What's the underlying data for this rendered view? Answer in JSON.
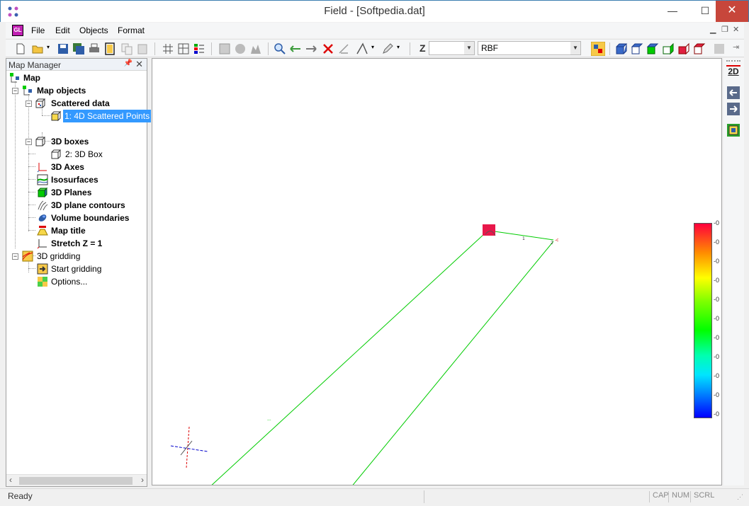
{
  "window": {
    "title": "Field - [Softpedia.dat]"
  },
  "menu": {
    "items": [
      "File",
      "Edit",
      "Objects",
      "Format"
    ],
    "doc_icon_text": "GL"
  },
  "toolbar": {
    "z_label": "Z",
    "z_combo_value": "",
    "method_combo_value": "RBF"
  },
  "panel": {
    "title": "Map Manager",
    "tree": {
      "map": "Map",
      "map_objects": "Map objects",
      "scattered_data": "Scattered data",
      "scattered_points": "1: 4D Scattered Points",
      "boxes": "3D boxes",
      "box": "2: 3D Box",
      "axes": "3D Axes",
      "isosurfaces": "Isosurfaces",
      "planes": "3D Planes",
      "plane_contours": "3D plane contours",
      "volume_boundaries": "Volume boundaries",
      "map_title": "Map title",
      "stretch": "Stretch Z = 1",
      "gridding": "3D gridding",
      "start_gridding": "Start gridding",
      "options": "Options..."
    }
  },
  "sidebar": {
    "mode_label": "2D"
  },
  "colorbar": {
    "tick_labels": [
      "-0",
      "-0",
      "-0",
      "-0",
      "-0",
      "-0",
      "-0",
      "-0",
      "-0",
      "-0",
      "-0"
    ],
    "colors": [
      "#ff003c",
      "#ff8c00",
      "#ffff00",
      "#7fff00",
      "#00ff00",
      "#00ffb0",
      "#00e5ff",
      "#0080ff",
      "#0000ff"
    ]
  },
  "status": {
    "text": "Ready",
    "cap": "CAP",
    "num": "NUM",
    "scrl": "SCRL"
  }
}
